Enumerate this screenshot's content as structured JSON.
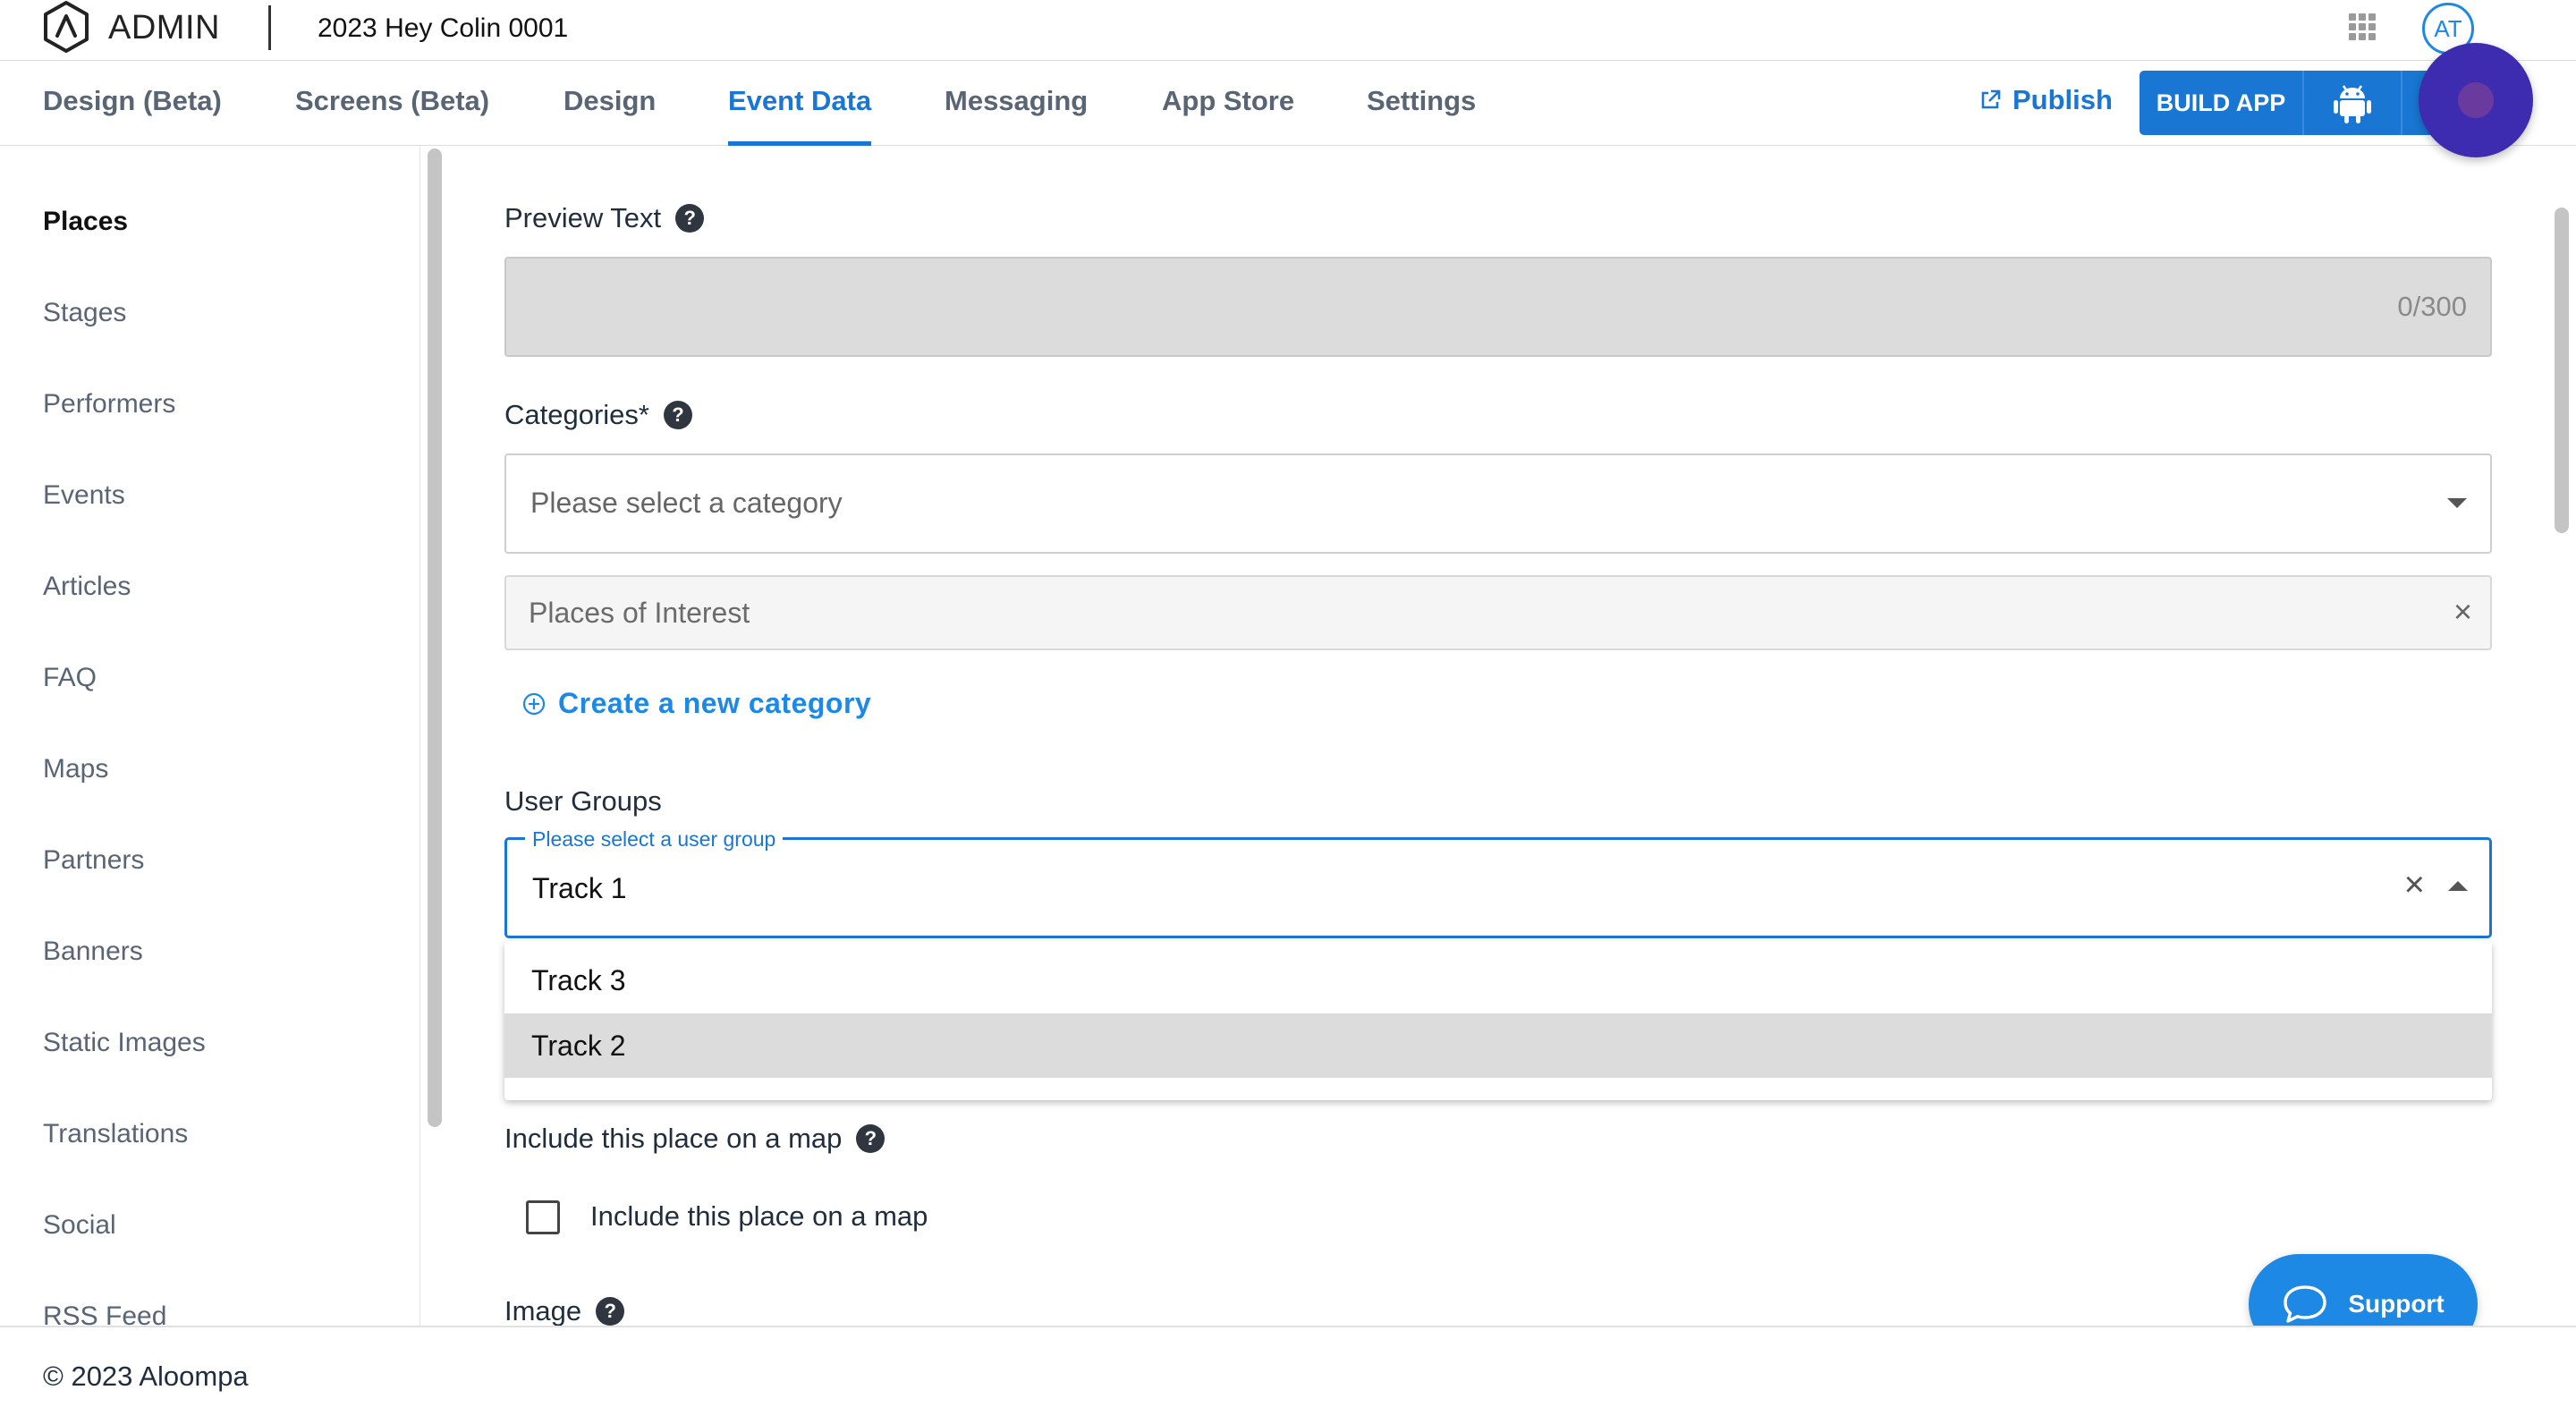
{
  "header": {
    "logo_text": "ADMIN",
    "app_title": "2023 Hey Colin 0001",
    "avatar_initials": "AT"
  },
  "nav": {
    "tabs": [
      {
        "label": "Design (Beta)"
      },
      {
        "label": "Screens (Beta)"
      },
      {
        "label": "Design"
      },
      {
        "label": "Event Data",
        "active": true
      },
      {
        "label": "Messaging"
      },
      {
        "label": "App Store"
      },
      {
        "label": "Settings"
      }
    ],
    "publish_label": "Publish",
    "build_label": "BUILD APP"
  },
  "sidebar": {
    "items": [
      {
        "label": "Places",
        "active": true
      },
      {
        "label": "Stages"
      },
      {
        "label": "Performers"
      },
      {
        "label": "Events"
      },
      {
        "label": "Articles"
      },
      {
        "label": "FAQ"
      },
      {
        "label": "Maps"
      },
      {
        "label": "Partners"
      },
      {
        "label": "Banners"
      },
      {
        "label": "Static Images"
      },
      {
        "label": "Translations"
      },
      {
        "label": "Social"
      },
      {
        "label": "RSS Feed"
      }
    ]
  },
  "form": {
    "preview_text": {
      "label": "Preview Text",
      "counter": "0/300"
    },
    "categories": {
      "label": "Categories*",
      "placeholder": "Please select a category",
      "selected_chip": "Places of Interest",
      "create_label": "Create a new category"
    },
    "user_groups": {
      "label": "User Groups",
      "legend": "Please select a user group",
      "value": "Track 1",
      "options": [
        {
          "label": "Track 3"
        },
        {
          "label": "Track 2",
          "hovered": true
        }
      ]
    },
    "map": {
      "label": "Include this place on a map",
      "checkbox_label": "Include this place on a map",
      "checked": false
    },
    "image": {
      "label": "Image"
    }
  },
  "support": {
    "label": "Support"
  },
  "footer": {
    "text": "© 2023 Aloompa"
  },
  "colors": {
    "accent": "#1976d2",
    "link": "#1e88e5",
    "recording": "#3d2bb0"
  }
}
